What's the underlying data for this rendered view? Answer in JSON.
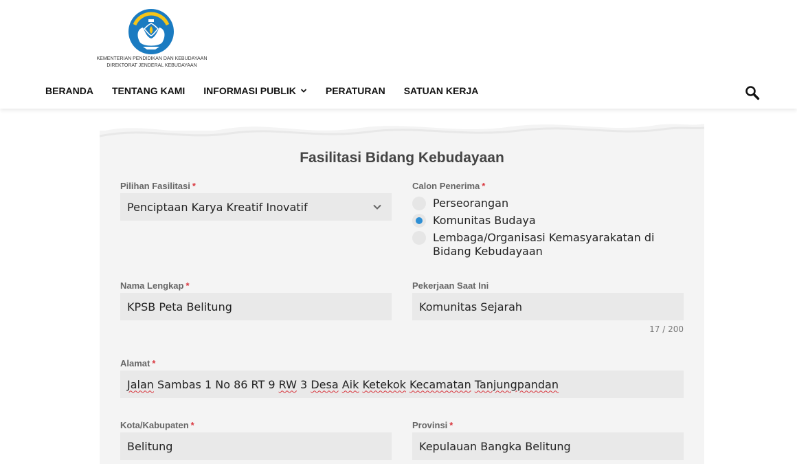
{
  "logo": {
    "line1": "KEMENTERIAN PENDIDIKAN DAN KEBUDAYAAN",
    "line2": "DIREKTORAT JENDERAL KEBUDAYAAN",
    "emblem_text": "TUT WURI HANDAYANI",
    "colors": {
      "emblem_blue": "#1a7bc1",
      "emblem_white": "#ffffff",
      "emblem_yellow": "#f5c518"
    }
  },
  "nav": {
    "items": [
      {
        "label": "BERANDA"
      },
      {
        "label": "TENTANG KAMI"
      },
      {
        "label": "INFORMASI PUBLIK",
        "has_dropdown": true
      },
      {
        "label": "PERATURAN"
      },
      {
        "label": "SATUAN KERJA"
      }
    ],
    "search_icon": "search-icon"
  },
  "form": {
    "title": "Fasilitasi Bidang Kebudayaan",
    "pilihan_fasilitasi": {
      "label": "Pilihan Fasilitasi",
      "required_mark": "*",
      "value": "Penciptaan Karya Kreatif Inovatif"
    },
    "calon_penerima": {
      "label": "Calon Penerima",
      "required_mark": "*",
      "options": [
        {
          "label": "Perseorangan",
          "checked": false
        },
        {
          "label": "Komunitas Budaya",
          "checked": true
        },
        {
          "label": "Lembaga/Organisasi Kemasyarakatan di Bidang Kebudayaan",
          "checked": false
        }
      ]
    },
    "nama_lengkap": {
      "label": "Nama Lengkap",
      "required_mark": "*",
      "value": "KPSB Peta Belitung"
    },
    "pekerjaan": {
      "label": "Pekerjaan Saat Ini",
      "value": "Komunitas Sejarah",
      "counter": "17 / 200"
    },
    "alamat": {
      "label": "Alamat",
      "required_mark": "*",
      "value": "Jalan Sambas 1 No 86 RT 9 RW 3 Desa Aik Ketekok Kecamatan Tanjungpandan"
    },
    "kota": {
      "label": "Kota/Kabupaten",
      "required_mark": "*",
      "value": "Belitung"
    },
    "provinsi": {
      "label": "Provinsi",
      "required_mark": "*",
      "value": "Kepulauan Bangka Belitung"
    }
  },
  "colors": {
    "required": "#d9363e",
    "radio_checked": "#2d8fd5",
    "field_bg": "#e9e9e9",
    "card_bg": "#f4f4f4"
  }
}
